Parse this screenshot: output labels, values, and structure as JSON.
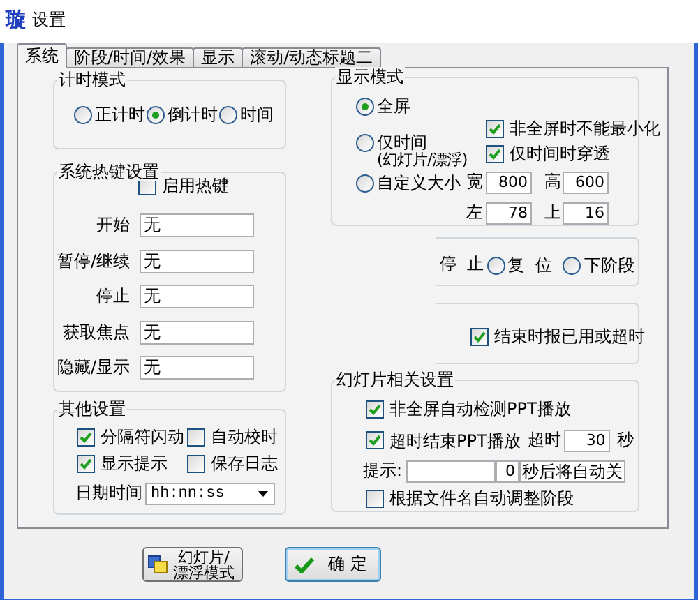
{
  "window": {
    "title": "设置",
    "icon": "璇"
  },
  "tabs": [
    {
      "label": "系统",
      "selected": true
    },
    {
      "label": "阶段/时间/效果",
      "selected": false
    },
    {
      "label": "显示",
      "selected": false
    },
    {
      "label": "滚动/动态标题二",
      "selected": false
    }
  ],
  "timer_mode": {
    "title": "计时模式",
    "options": [
      {
        "label": "正计时",
        "selected": false
      },
      {
        "label": "倒计时",
        "selected": true
      },
      {
        "label": "时间",
        "selected": false
      }
    ]
  },
  "hotkeys": {
    "title": "系统热键设置",
    "enable": {
      "label": "启用热键",
      "checked": false
    },
    "fields": [
      {
        "label": "开始",
        "value": "无"
      },
      {
        "label": "暂停/继续",
        "value": "无"
      },
      {
        "label": "停止",
        "value": "无"
      },
      {
        "label": "获取焦点",
        "value": "无"
      },
      {
        "label": "隐藏/显示",
        "value": "无"
      }
    ]
  },
  "other": {
    "title": "其他设置",
    "options": [
      {
        "label": "分隔符闪动",
        "checked": true
      },
      {
        "label": "自动校时",
        "checked": false
      },
      {
        "label": "显示提示",
        "checked": true
      },
      {
        "label": "保存日志",
        "checked": false
      }
    ],
    "date_format": {
      "label": "日期时间",
      "value": "hh:nn:ss"
    }
  },
  "display_mode": {
    "title": "显示模式",
    "options": [
      {
        "label": "全屏",
        "selected": true
      },
      {
        "label": "仅时间",
        "note": "(幻灯片/漂浮)",
        "selected": false
      },
      {
        "label": "自定义大小",
        "selected": false
      }
    ],
    "flags": [
      {
        "label": "非全屏时不能最小化",
        "checked": true
      },
      {
        "label": "仅时间时穿透",
        "checked": true
      }
    ],
    "size": [
      {
        "label": "宽",
        "value": "800"
      },
      {
        "label": "高",
        "value": "600"
      },
      {
        "label": "左",
        "value": "78"
      },
      {
        "label": "上",
        "value": "16"
      }
    ]
  },
  "stop_action": {
    "label": "停  止",
    "options": [
      {
        "label": "复  位",
        "selected": false
      },
      {
        "label": "下阶段",
        "selected": false
      }
    ]
  },
  "end_report": {
    "label": "结束时报已用或超时",
    "checked": true
  },
  "slideshow": {
    "title": "幻灯片相关设置",
    "auto_detect": {
      "label": "非全屏自动检测PPT播放",
      "checked": true
    },
    "timeout_end": {
      "label": "超时结束PPT播放",
      "checked": true
    },
    "timeout": {
      "label": "超时",
      "value": "30",
      "unit": "秒"
    },
    "hint": {
      "label": "提示:",
      "count": "0",
      "suffix": "秒后将自动关"
    },
    "match_filename": {
      "label": "根据文件名自动调整阶段",
      "checked": false
    }
  },
  "buttons": [
    {
      "label": "幻灯片/漂浮模式",
      "kind": "slides"
    },
    {
      "label": "确 定",
      "kind": "ok"
    }
  ]
}
